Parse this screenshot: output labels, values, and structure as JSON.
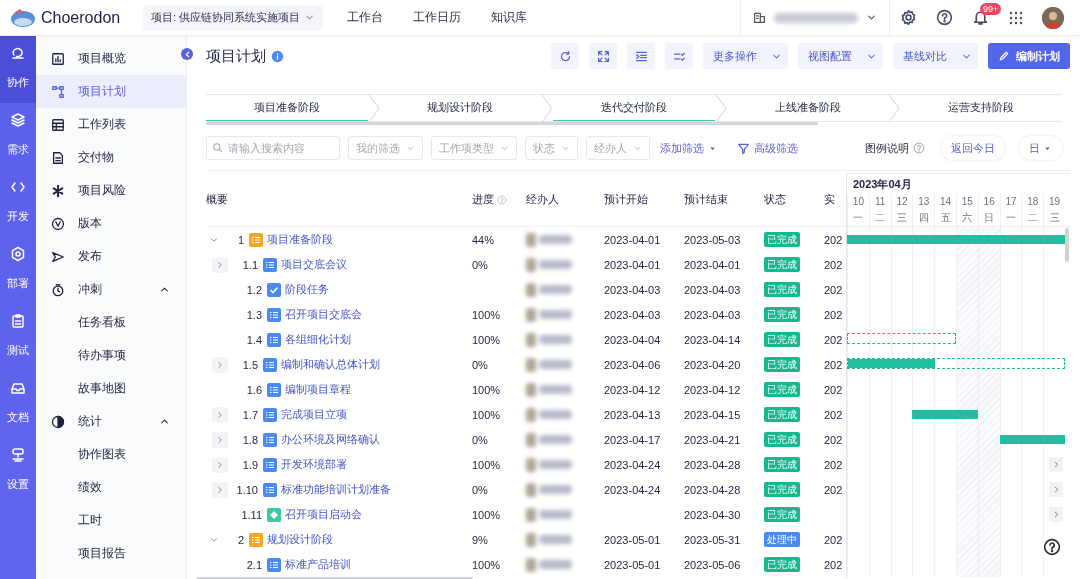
{
  "header": {
    "logo": "Choerodon",
    "project_selector": "项目: 供应链协同系统实施项目",
    "nav": [
      "工作台",
      "工作日历",
      "知识库"
    ],
    "notification_count": "99+"
  },
  "rail": [
    {
      "label": "协作",
      "selected": true
    },
    {
      "label": "需求",
      "selected": false
    },
    {
      "label": "开发",
      "selected": false
    },
    {
      "label": "部署",
      "selected": false
    },
    {
      "label": "测试",
      "selected": false
    },
    {
      "label": "文档",
      "selected": false
    },
    {
      "label": "设置",
      "selected": false
    }
  ],
  "sidebar": {
    "items": [
      {
        "label": "项目概览",
        "selected": false
      },
      {
        "label": "项目计划",
        "selected": true
      },
      {
        "label": "工作列表",
        "selected": false
      },
      {
        "label": "交付物",
        "selected": false
      },
      {
        "label": "项目风险",
        "selected": false
      },
      {
        "label": "版本",
        "selected": false
      },
      {
        "label": "发布",
        "selected": false
      },
      {
        "label": "冲刺",
        "selected": false,
        "expanded": true,
        "children": [
          {
            "label": "任务看板",
            "selected": false
          },
          {
            "label": "待办事项",
            "selected": false
          },
          {
            "label": "故事地图",
            "selected": false
          }
        ]
      },
      {
        "label": "统计",
        "selected": false,
        "expanded": true,
        "children": [
          {
            "label": "协作图表",
            "selected": false
          },
          {
            "label": "绩效",
            "selected": false
          },
          {
            "label": "工时",
            "selected": false
          },
          {
            "label": "项目报告",
            "selected": false
          }
        ]
      }
    ]
  },
  "page": {
    "title": "项目计划",
    "actions": [
      "更多操作",
      "视图配置",
      "基线对比"
    ],
    "primary_action": "编制计划"
  },
  "stages": [
    {
      "label": "项目准备阶段",
      "completed": true
    },
    {
      "label": "规划设计阶段",
      "completed": false
    },
    {
      "label": "迭代交付阶段",
      "completed": true
    },
    {
      "label": "上线准备阶段",
      "completed": false
    },
    {
      "label": "运营支持阶段",
      "completed": false
    }
  ],
  "filters": {
    "search": {
      "placeholder": "请输入搜索内容"
    },
    "dropdowns": [
      "我的筛选",
      "工作项类型",
      "状态",
      "经办人"
    ],
    "add_filter": "添加筛选",
    "advanced_filter": "高级筛选",
    "legend": "图例说明",
    "today_button": "返回今日",
    "scale": "日"
  },
  "table": {
    "columns": [
      "概要",
      "进度",
      "经办人",
      "预计开始",
      "预计结束",
      "状态",
      "实"
    ],
    "rows": [
      {
        "number": "1",
        "title": "项目准备阶段",
        "kind": "stage",
        "expanded": true,
        "progress": "44%",
        "start": "2023-04-01",
        "end": "2023-05-03",
        "status": "已完成",
        "color": "#17b890",
        "actual": "202",
        "bar": {
          "kind": "solid"
        },
        "children": [
          {
            "number": "1.1",
            "title": "项目交底会议",
            "kind": "task",
            "expanded": false,
            "progress": "0%",
            "start": "2023-04-01",
            "end": "2023-04-01",
            "status": "已完成",
            "color": "#17b890",
            "actual": "202"
          },
          {
            "number": "1.2",
            "title": "阶段任务",
            "kind": "check",
            "start": "2023-04-03",
            "end": "2023-04-03",
            "status": "已完成",
            "color": "#17b890",
            "actual": "202"
          },
          {
            "number": "1.3",
            "title": "召开项目交底会",
            "kind": "task",
            "progress": "100%",
            "start": "2023-04-03",
            "end": "2023-04-03",
            "status": "已完成",
            "color": "#17b890",
            "actual": "202"
          },
          {
            "number": "1.4",
            "title": "各组细化计划",
            "kind": "task",
            "progress": "100%",
            "start": "2023-04-04",
            "end": "2023-04-14",
            "status": "已完成",
            "color": "#17b890",
            "actual": "202",
            "bar": {
              "kind": "outline"
            }
          },
          {
            "number": "1.5",
            "title": "编制和确认总体计划",
            "kind": "task",
            "expanded": false,
            "progress": "0%",
            "start": "2023-04-06",
            "end": "2023-04-20",
            "status": "已完成",
            "color": "#17b890",
            "actual": "202",
            "bar": {
              "kind": "mixed"
            }
          },
          {
            "number": "1.6",
            "title": "编制项目章程",
            "kind": "task",
            "progress": "100%",
            "start": "2023-04-12",
            "end": "2023-04-12",
            "status": "已完成",
            "color": "#17b890",
            "actual": "202"
          },
          {
            "number": "1.7",
            "title": "完成项目立项",
            "kind": "task",
            "expanded": false,
            "progress": "100%",
            "start": "2023-04-13",
            "end": "2023-04-15",
            "status": "已完成",
            "color": "#17b890",
            "actual": "202",
            "bar": {
              "kind": "solid"
            }
          },
          {
            "number": "1.8",
            "title": "办公环境及网络确认",
            "kind": "task",
            "expanded": false,
            "progress": "0%",
            "start": "2023-04-17",
            "end": "2023-04-21",
            "status": "已完成",
            "color": "#17b890",
            "actual": "202",
            "bar": {
              "kind": "solid"
            }
          },
          {
            "number": "1.9",
            "title": "开发环境部署",
            "kind": "task",
            "expanded": false,
            "progress": "100%",
            "start": "2023-04-24",
            "end": "2023-04-28",
            "status": "已完成",
            "color": "#17b890",
            "actual": "202",
            "bar": {
              "kind": "after"
            }
          },
          {
            "number": "1.10",
            "title": "标准功能培训计划准备",
            "kind": "task",
            "expanded": false,
            "progress": "0%",
            "start": "2023-04-24",
            "end": "2023-04-28",
            "status": "已完成",
            "color": "#17b890",
            "actual": "202",
            "bar": {
              "kind": "after"
            }
          },
          {
            "number": "1.11",
            "title": "召开项目启动会",
            "kind": "milestone",
            "progress": "100%",
            "end": "2023-04-30",
            "status": "已完成",
            "color": "#17b890",
            "bar": {
              "kind": "after"
            }
          }
        ]
      },
      {
        "number": "2",
        "title": "规划设计阶段",
        "kind": "stage",
        "expanded": true,
        "progress": "9%",
        "start": "2023-05-01",
        "end": "2023-05-31",
        "status": "处理中",
        "color": "#4a8af4",
        "actual": "202",
        "children": [
          {
            "number": "2.1",
            "title": "标准产品培训",
            "kind": "task",
            "progress": "100%",
            "start": "2023-05-01",
            "end": "2023-05-06",
            "status": "已完成",
            "color": "#17b890",
            "actual": "202"
          }
        ]
      }
    ]
  },
  "gantt": {
    "month": "2023年04月",
    "days": [
      {
        "day": "10",
        "weekday": "一",
        "weekend": false
      },
      {
        "day": "11",
        "weekday": "二",
        "weekend": false
      },
      {
        "day": "12",
        "weekday": "三",
        "weekend": false
      },
      {
        "day": "13",
        "weekday": "四",
        "weekend": false
      },
      {
        "day": "14",
        "weekday": "五",
        "weekend": false
      },
      {
        "day": "15",
        "weekday": "六",
        "weekend": true
      },
      {
        "day": "16",
        "weekday": "日",
        "weekend": true
      },
      {
        "day": "17",
        "weekday": "一",
        "weekend": false
      },
      {
        "day": "18",
        "weekday": "二",
        "weekend": false
      },
      {
        "day": "19",
        "weekday": "三",
        "weekend": false
      }
    ]
  }
}
